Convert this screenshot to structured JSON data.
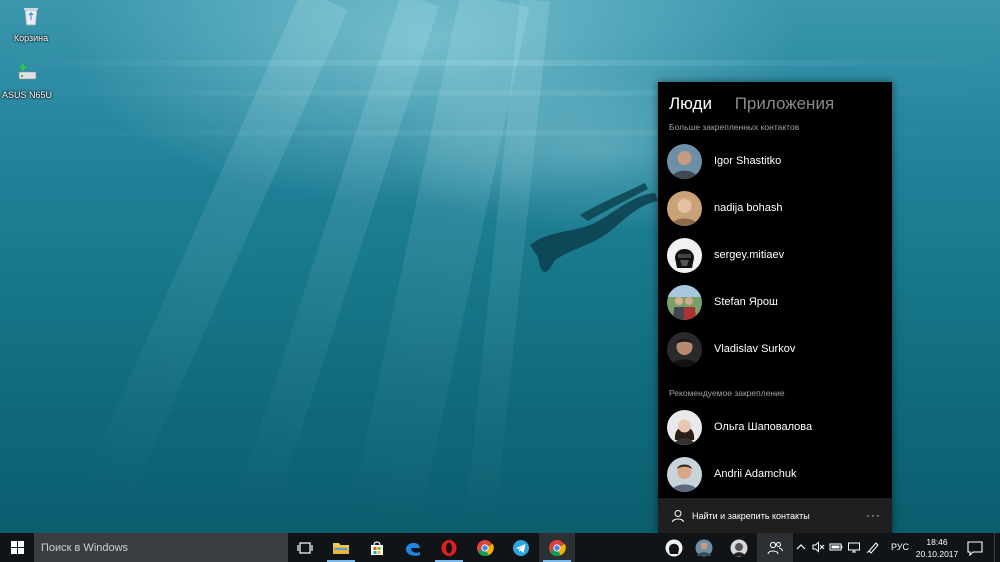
{
  "desktop": {
    "icons": [
      {
        "label": "Корзина",
        "icon": "recycle-bin-icon"
      },
      {
        "label": "ASUS N65U",
        "icon": "network-drive-icon"
      }
    ]
  },
  "people_flyout": {
    "tabs": [
      {
        "label": "Люди",
        "active": true
      },
      {
        "label": "Приложения",
        "active": false
      }
    ],
    "pinned_section_label": "Больше закрепленных контактов",
    "pinned_contacts": [
      {
        "name": "Igor Shastitko"
      },
      {
        "name": "nadija bohash"
      },
      {
        "name": "sergey.mitiaev"
      },
      {
        "name": "Stefan Ярош"
      },
      {
        "name": "Vladislav Surkov"
      }
    ],
    "suggested_section_label": "Рекомендуемое закрепление",
    "suggested_contacts": [
      {
        "name": "Ольга Шаповалова"
      },
      {
        "name": "Andrii Adamchuk"
      }
    ],
    "footer": {
      "find_label": "Найти и закрепить контакты",
      "more_label": "···"
    }
  },
  "taskbar": {
    "search_placeholder": "Поиск в Windows",
    "apps": [
      {
        "name": "task-view",
        "icon": "task-view-icon"
      },
      {
        "name": "file-explorer",
        "icon": "folder-icon"
      },
      {
        "name": "store",
        "icon": "store-icon"
      },
      {
        "name": "edge",
        "icon": "edge-icon"
      },
      {
        "name": "opera",
        "icon": "opera-icon"
      },
      {
        "name": "chrome",
        "icon": "chrome-icon"
      },
      {
        "name": "telegram",
        "icon": "telegram-icon"
      },
      {
        "name": "chrome-2",
        "icon": "chrome-icon"
      }
    ],
    "language": "РУС",
    "time": "18:46",
    "date": "20.10.2017",
    "accent_color": "#76b9ed"
  }
}
